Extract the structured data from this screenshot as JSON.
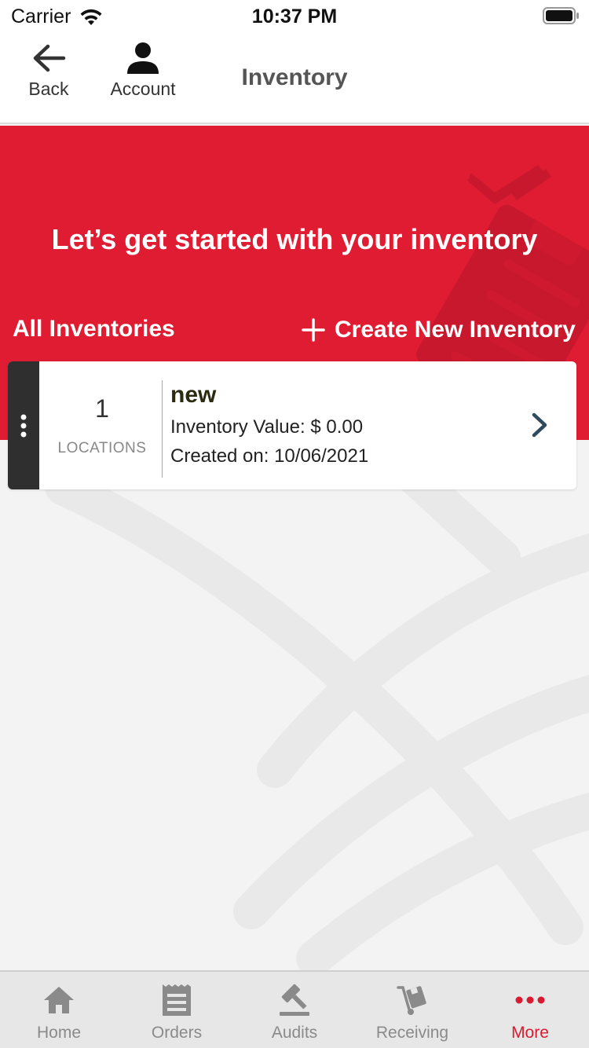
{
  "status_bar": {
    "carrier": "Carrier",
    "time": "10:37 PM"
  },
  "nav": {
    "back_label": "Back",
    "account_label": "Account",
    "title": "Inventory"
  },
  "hero": {
    "headline": "Let’s get started with your inventory",
    "all_inventories_label": "All Inventories",
    "create_label": "Create New Inventory"
  },
  "inventories": [
    {
      "location_count": "1",
      "locations_label": "LOCATIONS",
      "name": "new",
      "value_text": "Inventory Value: $ 0.00",
      "created_text": "Created on: 10/06/2021"
    }
  ],
  "tabs": [
    {
      "label": "Home",
      "icon": "home-icon",
      "active": false
    },
    {
      "label": "Orders",
      "icon": "receipt-icon",
      "active": false
    },
    {
      "label": "Audits",
      "icon": "gavel-icon",
      "active": false
    },
    {
      "label": "Receiving",
      "icon": "hand-truck-icon",
      "active": false
    },
    {
      "label": "More",
      "icon": "more-dots-icon",
      "active": true
    }
  ],
  "colors": {
    "brand_red": "#e01c33",
    "active_tab": "#d81b31",
    "inactive_tab": "#8a8a8a",
    "card_handle": "#2f2f2f"
  }
}
